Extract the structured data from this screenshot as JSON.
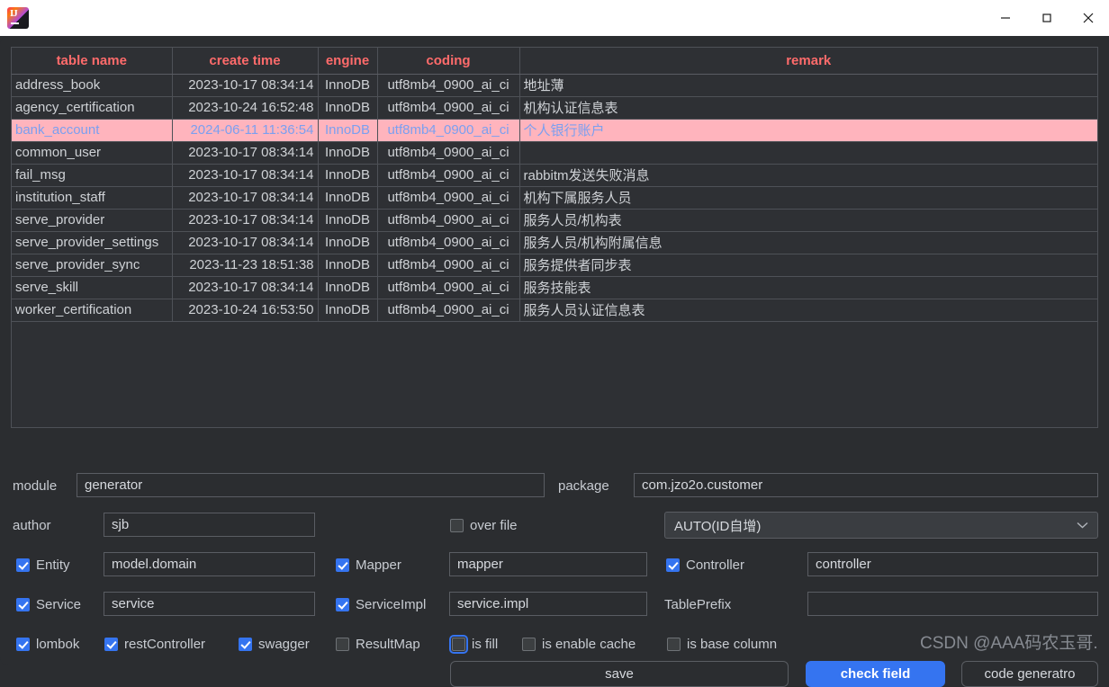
{
  "window": {
    "icon_name": "intellij-idea-icon",
    "minimize_label": "–",
    "maximize_label": "□",
    "close_label": "✕"
  },
  "table": {
    "columns": [
      "table name",
      "create time",
      "engine",
      "coding",
      "remark"
    ],
    "rows": [
      {
        "name": "address_book",
        "create_time": "2023-10-17 08:34:14",
        "engine": "InnoDB",
        "coding": "utf8mb4_0900_ai_ci",
        "remark": "地址薄",
        "selected": false
      },
      {
        "name": "agency_certification",
        "create_time": "2023-10-24 16:52:48",
        "engine": "InnoDB",
        "coding": "utf8mb4_0900_ai_ci",
        "remark": "机构认证信息表",
        "selected": false
      },
      {
        "name": "bank_account",
        "create_time": "2024-06-11 11:36:54",
        "engine": "InnoDB",
        "coding": "utf8mb4_0900_ai_ci",
        "remark": "个人银行账户",
        "selected": true
      },
      {
        "name": "common_user",
        "create_time": "2023-10-17 08:34:14",
        "engine": "InnoDB",
        "coding": "utf8mb4_0900_ai_ci",
        "remark": "",
        "selected": false
      },
      {
        "name": "fail_msg",
        "create_time": "2023-10-17 08:34:14",
        "engine": "InnoDB",
        "coding": "utf8mb4_0900_ai_ci",
        "remark": "rabbitm发送失败消息",
        "selected": false
      },
      {
        "name": "institution_staff",
        "create_time": "2023-10-17 08:34:14",
        "engine": "InnoDB",
        "coding": "utf8mb4_0900_ai_ci",
        "remark": "机构下属服务人员",
        "selected": false
      },
      {
        "name": "serve_provider",
        "create_time": "2023-10-17 08:34:14",
        "engine": "InnoDB",
        "coding": "utf8mb4_0900_ai_ci",
        "remark": "服务人员/机构表",
        "selected": false
      },
      {
        "name": "serve_provider_settings",
        "create_time": "2023-10-17 08:34:14",
        "engine": "InnoDB",
        "coding": "utf8mb4_0900_ai_ci",
        "remark": "服务人员/机构附属信息",
        "selected": false
      },
      {
        "name": "serve_provider_sync",
        "create_time": "2023-11-23 18:51:38",
        "engine": "InnoDB",
        "coding": "utf8mb4_0900_ai_ci",
        "remark": "服务提供者同步表",
        "selected": false
      },
      {
        "name": "serve_skill",
        "create_time": "2023-10-17 08:34:14",
        "engine": "InnoDB",
        "coding": "utf8mb4_0900_ai_ci",
        "remark": "服务技能表",
        "selected": false
      },
      {
        "name": "worker_certification",
        "create_time": "2023-10-24 16:53:50",
        "engine": "InnoDB",
        "coding": "utf8mb4_0900_ai_ci",
        "remark": "服务人员认证信息表",
        "selected": false
      }
    ]
  },
  "form": {
    "module_label": "module",
    "module_value": "generator",
    "package_label": "package",
    "package_value": "com.jzo2o.customer",
    "author_label": "author",
    "author_value": "sjb",
    "over_file_label": "over file",
    "over_file_checked": false,
    "id_strategy_value": "AUTO(ID自增)",
    "id_strategy_chevron": "⌄",
    "entity_label": "Entity",
    "entity_checked": true,
    "entity_value": "model.domain",
    "mapper_label": "Mapper",
    "mapper_checked": true,
    "mapper_value": "mapper",
    "controller_label": "Controller",
    "controller_checked": true,
    "controller_value": "controller",
    "service_label": "Service",
    "service_checked": true,
    "service_value": "service",
    "serviceimpl_label": "ServiceImpl",
    "serviceimpl_checked": true,
    "serviceimpl_value": "service.impl",
    "tableprefix_label": "TablePrefix",
    "tableprefix_value": "",
    "lombok_label": "lombok",
    "lombok_checked": true,
    "restcontroller_label": "restController",
    "restcontroller_checked": true,
    "swagger_label": "swagger",
    "swagger_checked": true,
    "resultmap_label": "ResultMap",
    "resultmap_checked": false,
    "isfill_label": "is fill",
    "isfill_checked": false,
    "isenablecache_label": "is enable cache",
    "isenablecache_checked": false,
    "isbasecolumn_label": "is base column",
    "isbasecolumn_checked": false,
    "save_label": "save",
    "check_field_label": "check field",
    "code_generator_label": "code generatro"
  },
  "watermark": {
    "text": "CSDN @AAA码农玉哥."
  },
  "colors": {
    "accent": "#3574f0",
    "header_text": "#ff6b6b",
    "selected_row_bg": "#ffb4bd",
    "selected_row_text": "#7b9ff0",
    "panel_bg": "#2b2d30"
  }
}
